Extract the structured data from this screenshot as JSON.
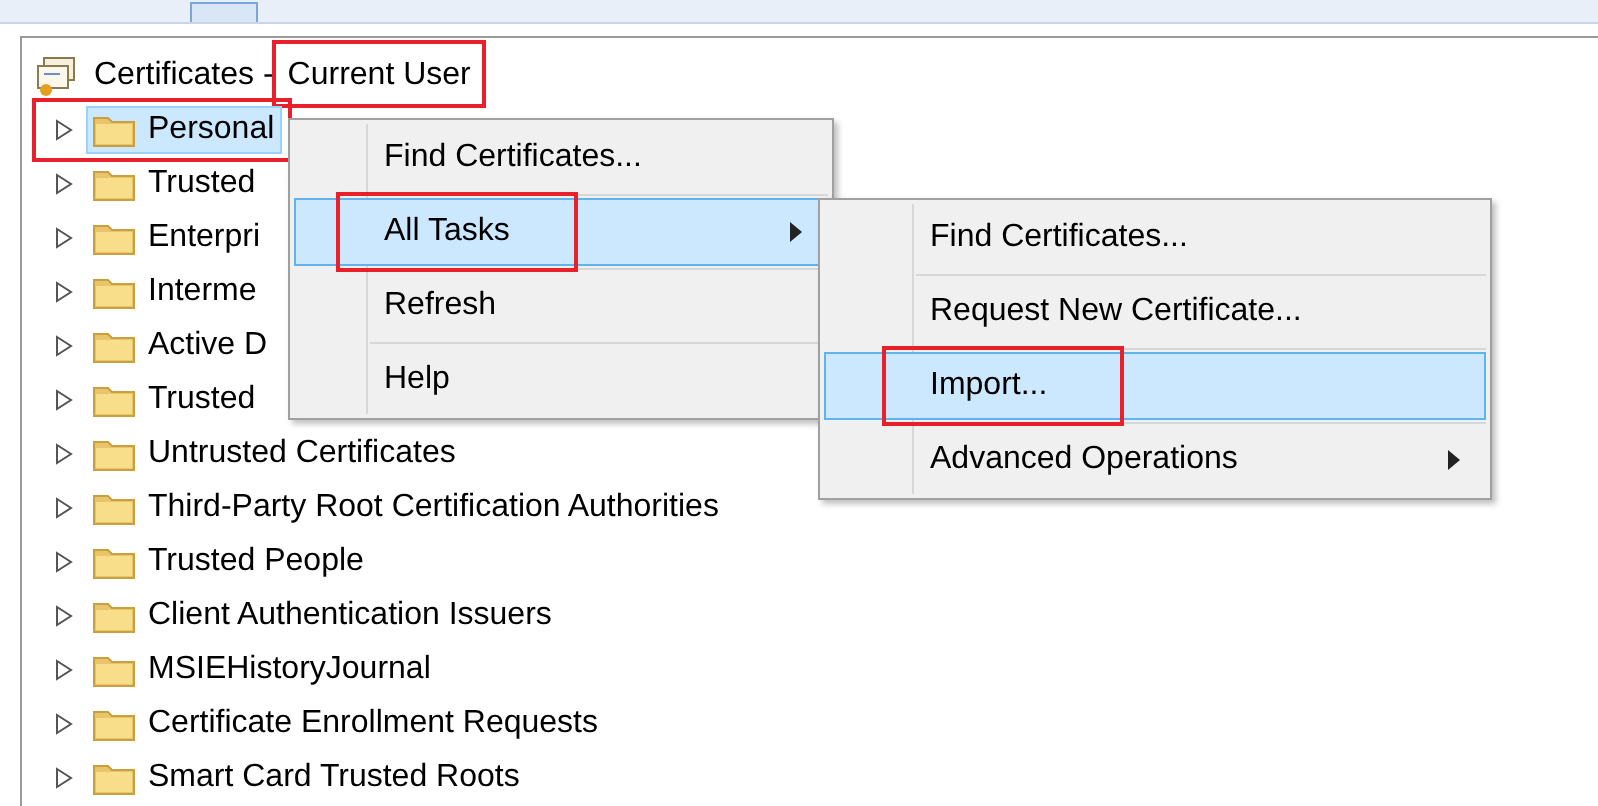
{
  "root": {
    "parts": [
      {
        "text": "Certificates -",
        "annotated": false
      },
      {
        "text": "Current User",
        "annotated": true
      }
    ]
  },
  "tree": [
    {
      "label": "Personal",
      "selected": true,
      "annotated": true
    },
    {
      "label": "Trusted",
      "selected": false,
      "annotated": false
    },
    {
      "label": "Enterpri",
      "selected": false,
      "annotated": false
    },
    {
      "label": "Interme",
      "selected": false,
      "annotated": false
    },
    {
      "label": "Active D",
      "selected": false,
      "annotated": false
    },
    {
      "label": "Trusted",
      "selected": false,
      "annotated": false
    },
    {
      "label": "Untrusted Certificates",
      "selected": false,
      "annotated": false
    },
    {
      "label": "Third-Party Root Certification Authorities",
      "selected": false,
      "annotated": false
    },
    {
      "label": "Trusted People",
      "selected": false,
      "annotated": false
    },
    {
      "label": "Client Authentication Issuers",
      "selected": false,
      "annotated": false
    },
    {
      "label": "MSIEHistoryJournal",
      "selected": false,
      "annotated": false
    },
    {
      "label": "Certificate Enrollment Requests",
      "selected": false,
      "annotated": false
    },
    {
      "label": "Smart Card Trusted Roots",
      "selected": false,
      "annotated": false
    }
  ],
  "context_menu": [
    {
      "label": "Find Certificates...",
      "selected": false,
      "annotated": false,
      "submenu": false
    },
    {
      "label": "All Tasks",
      "selected": true,
      "annotated": true,
      "submenu": true
    },
    {
      "label": "Refresh",
      "selected": false,
      "annotated": false,
      "submenu": false
    },
    {
      "label": "Help",
      "selected": false,
      "annotated": false,
      "submenu": false
    }
  ],
  "submenu": [
    {
      "label": "Find Certificates...",
      "selected": false,
      "annotated": false,
      "submenu": false
    },
    {
      "label": "Request New Certificate...",
      "selected": false,
      "annotated": false,
      "submenu": false
    },
    {
      "label": "Import...",
      "selected": true,
      "annotated": true,
      "submenu": false
    },
    {
      "label": "Advanced Operations",
      "selected": false,
      "annotated": false,
      "submenu": true
    }
  ]
}
